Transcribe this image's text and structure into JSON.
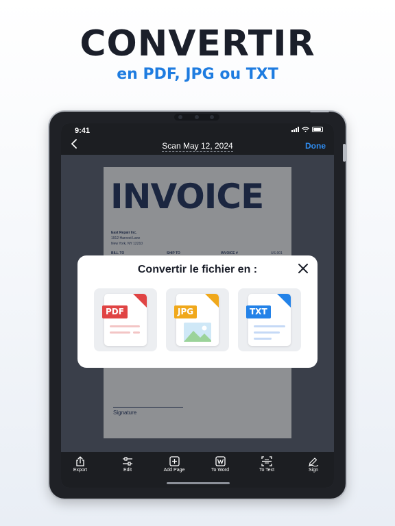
{
  "promo": {
    "headline": "CONVERTIR",
    "subheadline": "en PDF, JPG ou TXT"
  },
  "colors": {
    "accent": "#1e7ce0",
    "pdf": "#e04444",
    "jpg": "#f0a81b",
    "txt": "#2382e8"
  },
  "status_bar": {
    "time": "9:41"
  },
  "nav": {
    "back_icon": "chevron-left-icon",
    "title": "Scan May 12, 2024",
    "done_label": "Done"
  },
  "document": {
    "title": "INVOICE",
    "company_name": "East Repair Inc.",
    "company_address_1": "1912 Harvest Lane",
    "company_address_2": "New York, NY 12210",
    "bill_to": "BILL TO",
    "ship_to": "SHIP TO",
    "invoice_no": "INVOICE #",
    "invoice_value": "US-001",
    "signature_label": "Signature"
  },
  "modal": {
    "title": "Convertir le fichier en :",
    "close_icon": "close-icon",
    "formats": [
      {
        "label": "PDF",
        "icon": "pdf-file-icon"
      },
      {
        "label": "JPG",
        "icon": "jpg-file-icon"
      },
      {
        "label": "TXT",
        "icon": "txt-file-icon"
      }
    ]
  },
  "toolbar": {
    "items": [
      {
        "label": "Export",
        "icon": "share-icon"
      },
      {
        "label": "Edit",
        "icon": "sliders-icon"
      },
      {
        "label": "Add Page",
        "icon": "plus-square-icon"
      },
      {
        "label": "To Word",
        "icon": "word-icon"
      },
      {
        "label": "To Text",
        "icon": "text-scan-icon"
      },
      {
        "label": "Sign",
        "icon": "pen-icon"
      }
    ]
  }
}
